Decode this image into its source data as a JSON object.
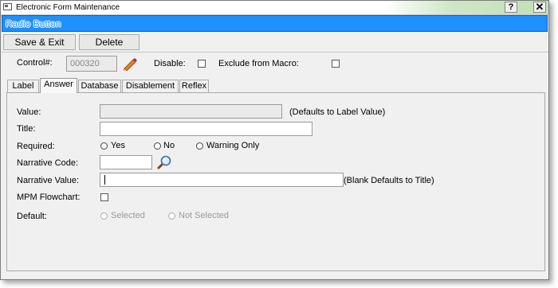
{
  "window": {
    "title": "Electronic Form Maintenance",
    "help_label": "?",
    "close_label": "✕",
    "banner": "Radio Button"
  },
  "toolbar": {
    "save_label": "Save & Exit",
    "delete_label": "Delete"
  },
  "header": {
    "control_label": "Control#:",
    "control_value": "000320",
    "disable_label": "Disable:",
    "disable_checked": false,
    "exclude_label": "Exclude from Macro:",
    "exclude_checked": false
  },
  "tabs": [
    {
      "label": "Label",
      "active": false
    },
    {
      "label": "Answer",
      "active": true
    },
    {
      "label": "Database",
      "active": false
    },
    {
      "label": "Disablement",
      "active": false
    },
    {
      "label": "Reflex",
      "active": false
    }
  ],
  "answer": {
    "value_label": "Value:",
    "value_value": "",
    "value_hint": "(Defaults to Label Value)",
    "title_label": "Title:",
    "title_value": "",
    "required_label": "Required:",
    "required_options": [
      "Yes",
      "No",
      "Warning Only"
    ],
    "narrative_code_label": "Narrative Code:",
    "narrative_code_value": "",
    "narrative_value_label": "Narrative Value:",
    "narrative_value_value": "",
    "narrative_value_hint": "(Blank Defaults to Title)",
    "mpm_label": "MPM Flowchart:",
    "mpm_checked": false,
    "default_label": "Default:",
    "default_options": [
      "Selected",
      "Not Selected"
    ]
  },
  "icons": {
    "pencil": "pencil-icon",
    "search": "magnifier-icon"
  },
  "colors": {
    "banner": "#1e90ff",
    "titlebar_accent": "#bfe0b4"
  }
}
